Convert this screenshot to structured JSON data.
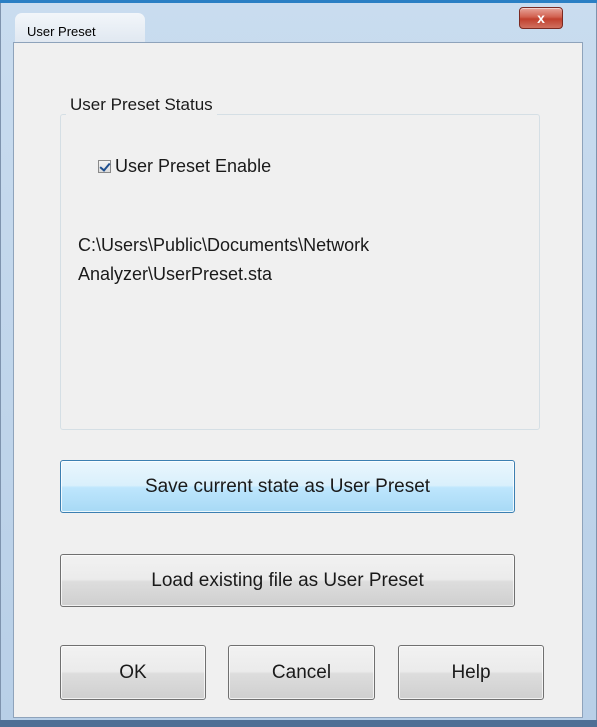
{
  "window": {
    "title": "User Preset",
    "close_label": "x"
  },
  "group": {
    "title": "User Preset Status",
    "checkbox_label": "User Preset Enable",
    "checkbox_checked": true,
    "path_line1": "C:\\Users\\Public\\Documents\\Network",
    "path_line2": "Analyzer\\UserPreset.sta"
  },
  "buttons": {
    "save_label": "Save current state as User Preset",
    "load_label": "Load existing file as User Preset",
    "ok_label": "OK",
    "cancel_label": "Cancel",
    "help_label": "Help"
  },
  "colors": {
    "accent": "#3c7fb1",
    "close_button": "#c1402e",
    "frame": "#b8cfe7"
  }
}
